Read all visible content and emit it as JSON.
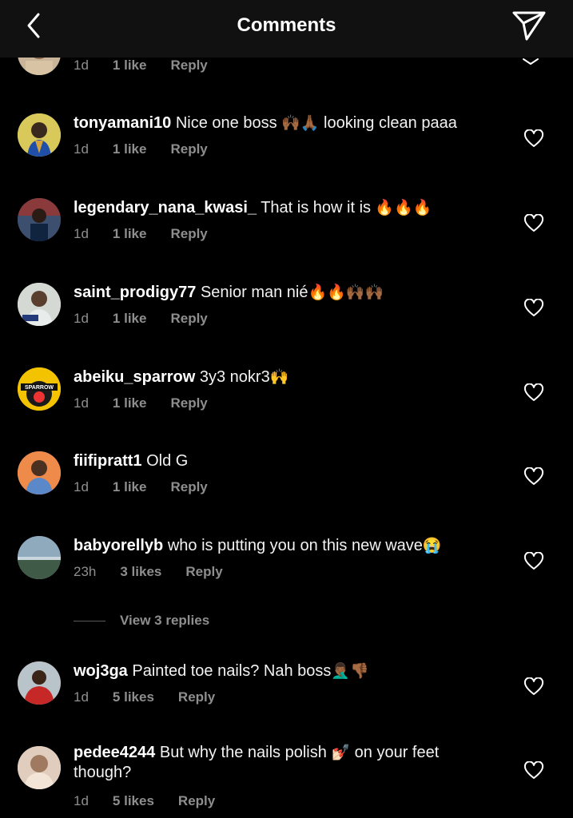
{
  "header": {
    "title": "Comments",
    "back_icon": "chevron-left-icon",
    "send_icon": "paper-plane-icon"
  },
  "partial_comment": {
    "time": "1d",
    "likes": "1 like",
    "reply": "Reply"
  },
  "comments": [
    {
      "username": "tonyamani10",
      "text": "Nice one boss",
      "emoji1": "🙌🏾🙏🏾",
      "text2": " looking clean paaa",
      "time": "1d",
      "likes": "1 like",
      "reply": "Reply"
    },
    {
      "username": "legendary_nana_kwasi_",
      "text": "That is how it is",
      "emoji1": " 🔥🔥🔥",
      "time": "1d",
      "likes": "1 like",
      "reply": "Reply"
    },
    {
      "username": "saint_prodigy77",
      "text": "Senior man nié",
      "emoji1": "🔥🔥🙌🏾🙌🏾",
      "time": "1d",
      "likes": "1 like",
      "reply": "Reply"
    },
    {
      "username": "abeiku_sparrow",
      "text": "3y3 nokr3",
      "emoji1": "🙌",
      "time": "1d",
      "likes": "1 like",
      "reply": "Reply",
      "avatar_label": "SPARROW"
    },
    {
      "username": "fiifipratt1",
      "text": "Old G",
      "time": "1d",
      "likes": "1 like",
      "reply": "Reply"
    },
    {
      "username": "babyorellyb",
      "text": "who is putting you on this new wave",
      "emoji1": "😭",
      "time": "23h",
      "likes": "3 likes",
      "reply": "Reply"
    },
    {
      "username": "woj3ga",
      "text": "Painted toe nails? Nah boss",
      "emoji1": "🤦🏾‍♂️👎🏾",
      "time": "1d",
      "likes": "5 likes",
      "reply": "Reply"
    },
    {
      "username": "pedee4244",
      "text": "But why the nails polish",
      "emoji1": "💅🏻",
      "text2": " on  your feet though?",
      "time": "1d",
      "likes": "5 likes",
      "reply": "Reply"
    }
  ],
  "view_replies": {
    "label": "View 3 replies"
  },
  "colors": {
    "background": "#000000",
    "header": "#111111",
    "meta": "#8e8e8e",
    "text": "#ffffff"
  }
}
